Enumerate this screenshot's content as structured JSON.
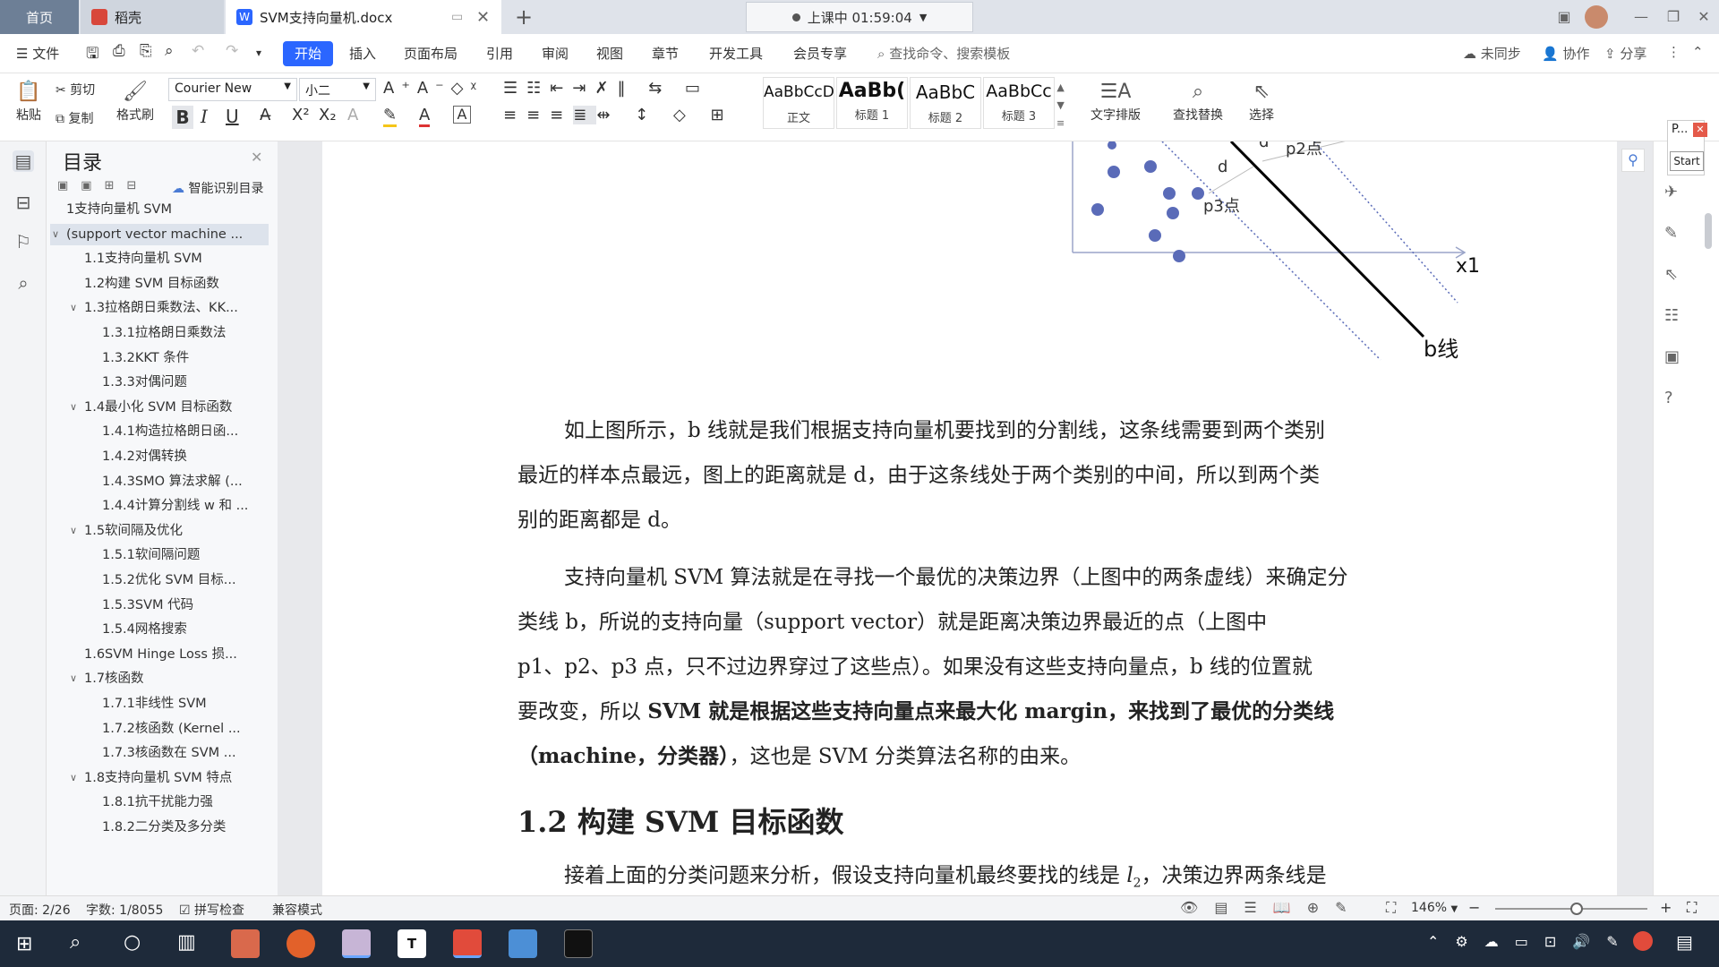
{
  "titlebar": {
    "tabs": [
      {
        "label": "首页"
      },
      {
        "label": "稻壳"
      },
      {
        "label": "SVM支持向量机.docx"
      }
    ],
    "lesson_status": "上课中 01:59:04",
    "add_tab": "+"
  },
  "menu": {
    "file": "文件",
    "items": [
      "开始",
      "插入",
      "页面布局",
      "引用",
      "审阅",
      "视图",
      "章节",
      "开发工具",
      "会员专享"
    ],
    "search_placeholder": "查找命令、搜索模板",
    "sync": "未同步",
    "collab": "协作",
    "share": "分享"
  },
  "ribbon": {
    "paste": "粘贴",
    "cut": "剪切",
    "copy": "复制",
    "format_painter": "格式刷",
    "font_name": "Courier New",
    "font_size": "小二",
    "styles": [
      {
        "preview": "AaBbCcDd",
        "name": "正文"
      },
      {
        "preview": "AaBb(",
        "name": "标题 1"
      },
      {
        "preview": "AaBbC",
        "name": "标题 2"
      },
      {
        "preview": "AaBbCc",
        "name": "标题 3"
      }
    ],
    "text_layout": "文字排版",
    "find_replace": "查找替换",
    "select": "选择"
  },
  "toc": {
    "title": "目录",
    "smart_toc": "智能识别目录",
    "items": [
      {
        "label": "1支持向量机 SVM",
        "level": 0,
        "expander": ""
      },
      {
        "label": "(support vector machine ...",
        "level": 0,
        "expander": "v",
        "selected": true
      },
      {
        "label": "1.1支持向量机 SVM",
        "level": 1,
        "expander": ""
      },
      {
        "label": "1.2构建 SVM 目标函数",
        "level": 1,
        "expander": ""
      },
      {
        "label": "1.3拉格朗日乘数法、KK...",
        "level": 1,
        "expander": "v"
      },
      {
        "label": "1.3.1拉格朗日乘数法",
        "level": 2,
        "expander": ""
      },
      {
        "label": "1.3.2KKT 条件",
        "level": 2,
        "expander": ""
      },
      {
        "label": "1.3.3对偶问题",
        "level": 2,
        "expander": ""
      },
      {
        "label": "1.4最小化 SVM 目标函数",
        "level": 1,
        "expander": "v"
      },
      {
        "label": "1.4.1构造拉格朗日函...",
        "level": 2,
        "expander": ""
      },
      {
        "label": "1.4.2对偶转换",
        "level": 2,
        "expander": ""
      },
      {
        "label": "1.4.3SMO 算法求解 (...",
        "level": 2,
        "expander": ""
      },
      {
        "label": "1.4.4计算分割线 w 和 ...",
        "level": 2,
        "expander": ""
      },
      {
        "label": "1.5软间隔及优化",
        "level": 1,
        "expander": "v"
      },
      {
        "label": "1.5.1软间隔问题",
        "level": 2,
        "expander": ""
      },
      {
        "label": "1.5.2优化 SVM 目标...",
        "level": 2,
        "expander": ""
      },
      {
        "label": "1.5.3SVM 代码",
        "level": 2,
        "expander": ""
      },
      {
        "label": "1.5.4网格搜索",
        "level": 2,
        "expander": ""
      },
      {
        "label": "1.6SVM Hinge Loss 损...",
        "level": 1,
        "expander": ""
      },
      {
        "label": "1.7核函数",
        "level": 1,
        "expander": "v"
      },
      {
        "label": "1.7.1非线性 SVM",
        "level": 2,
        "expander": ""
      },
      {
        "label": "1.7.2核函数 (Kernel ...",
        "level": 2,
        "expander": ""
      },
      {
        "label": "1.7.3核函数在 SVM ...",
        "level": 2,
        "expander": ""
      },
      {
        "label": "1.8支持向量机 SVM 特点",
        "level": 1,
        "expander": "v"
      },
      {
        "label": "1.8.1抗干扰能力强",
        "level": 2,
        "expander": ""
      },
      {
        "label": "1.8.2二分类及多分类",
        "level": 2,
        "expander": ""
      }
    ]
  },
  "figure": {
    "labels": {
      "d_top": "d",
      "p2": "p2点",
      "d": "d",
      "p3": "p3点",
      "x1": "x1",
      "bline": "b线"
    }
  },
  "document": {
    "para1": [
      "如上图所示，b 线就是我们根据支持向量机要找到的分割线，这条线需要到两个类别",
      "最近的样本点最远，图上的距离就是 d，由于这条线处于两个类别的中间，所以到两个类",
      "别的距离都是 d。"
    ],
    "para2": [
      "支持向量机 SVM 算法就是在寻找一个最优的决策边界（上图中的两条虚线）来确定分",
      "类线 b，所说的支持向量（support  vector）就是距离决策边界最近的点（上图中",
      "p1、p2、p3 点，只不过边界穿过了这些点）。如果没有这些支持向量点，b 线的位置就",
      "要改变，所以 ",
      "SVM 就是根据这些支持向量点来最大化 margin，来找到了最优的分类线",
      "（machine，分类器）",
      "，这也是 SVM 分类算法名称的由来。"
    ],
    "heading": "1.2  构建 SVM 目标函数",
    "para3_a": "接着上面的分类问题来分析，假设支持向量机最终要找的线是 ",
    "para3_var": "l",
    "para3_sub": "2",
    "para3_b": "，决策边界两条线是"
  },
  "popup": {
    "title": "P...",
    "button": "Start"
  },
  "statusbar": {
    "page": "页面: 2/26",
    "words": "字数: 1/8055",
    "spell": "拼写检查",
    "compat": "兼容模式",
    "zoom": "146%"
  },
  "colors": {
    "accent": "#2b66ff",
    "taskbar": "#1e2a3a"
  }
}
